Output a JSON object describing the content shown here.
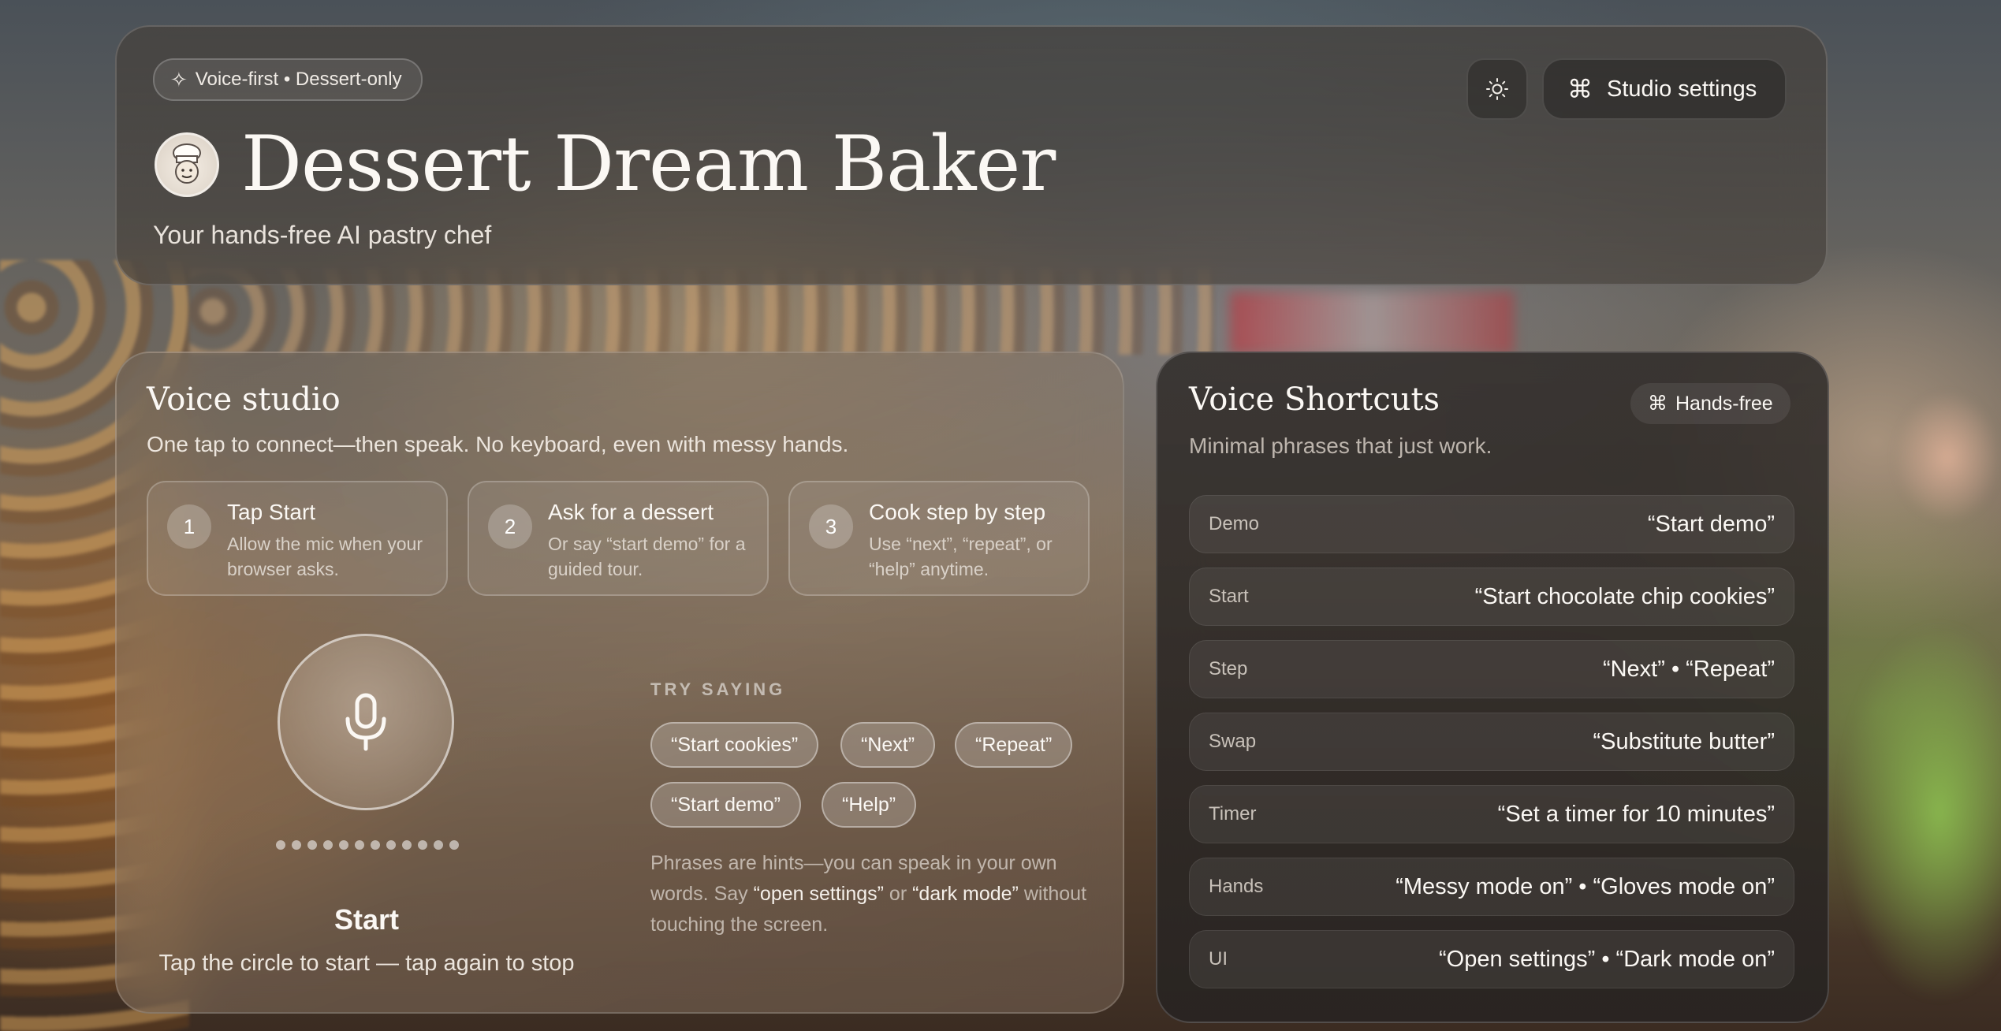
{
  "header": {
    "tag": "Voice-first • Dessert-only",
    "title": "Dessert Dream Baker",
    "subtitle": "Your hands-free AI pastry chef",
    "settings_label": "Studio settings",
    "settings_icon": "command-icon",
    "theme_icon": "sun-icon",
    "logo_icon": "chef-face-icon"
  },
  "studio": {
    "title": "Voice studio",
    "subtitle": "One tap to connect—then speak. No keyboard, even with messy hands.",
    "steps": [
      {
        "num": "1",
        "title": "Tap Start",
        "desc": "Allow the mic when your browser asks."
      },
      {
        "num": "2",
        "title": "Ask for a dessert",
        "desc": "Or say “start demo” for a guided tour."
      },
      {
        "num": "3",
        "title": "Cook step by step",
        "desc": "Use “next”, “repeat”, or “help” anytime."
      }
    ],
    "mic_label": "Start",
    "mic_hint": "Tap the circle to start — tap again to stop",
    "try_label": "TRY SAYING",
    "chips": [
      "“Start cookies”",
      "“Next”",
      "“Repeat”",
      "“Start demo”",
      "“Help”"
    ],
    "hint_part1": "Phrases are hints—you can speak in your own words. Say ",
    "hint_settings": "“open settings”",
    "hint_part2": " or ",
    "hint_dark": "“dark mode”",
    "hint_part3": " without touching the screen."
  },
  "shortcuts": {
    "title": "Voice Shortcuts",
    "subtitle": "Minimal phrases that just work.",
    "badge": "Hands-free",
    "rows": [
      {
        "key": "Demo",
        "phrase": "“Start demo”"
      },
      {
        "key": "Start",
        "phrase": "“Start chocolate chip cookies”"
      },
      {
        "key": "Step",
        "phrase": "“Next” • “Repeat”"
      },
      {
        "key": "Swap",
        "phrase": "“Substitute butter”"
      },
      {
        "key": "Timer",
        "phrase": "“Set a timer for 10 minutes”"
      },
      {
        "key": "Hands",
        "phrase": "“Messy mode on” • “Gloves mode on”"
      },
      {
        "key": "UI",
        "phrase": "“Open settings” • “Dark mode on”"
      }
    ]
  }
}
